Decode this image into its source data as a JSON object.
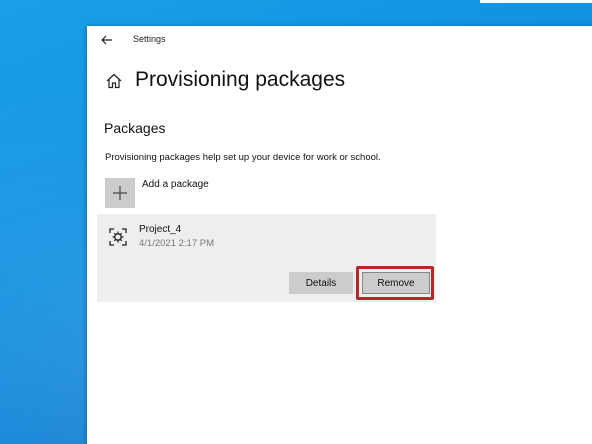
{
  "window": {
    "title": "Settings"
  },
  "page": {
    "title": "Provisioning packages"
  },
  "section": {
    "title": "Packages",
    "description": "Provisioning packages help set up your device for work or school."
  },
  "add_package": {
    "label": "Add a package",
    "icon": "plus-icon"
  },
  "package": {
    "name": "Project_4",
    "date": "4/1/2021 2:17 PM",
    "icon": "package-icon",
    "details_label": "Details",
    "remove_label": "Remove"
  },
  "colors": {
    "desktop": "#0f8ee0",
    "card": "#eeeeee",
    "button": "#cccccc",
    "highlight": "#b6272a"
  }
}
